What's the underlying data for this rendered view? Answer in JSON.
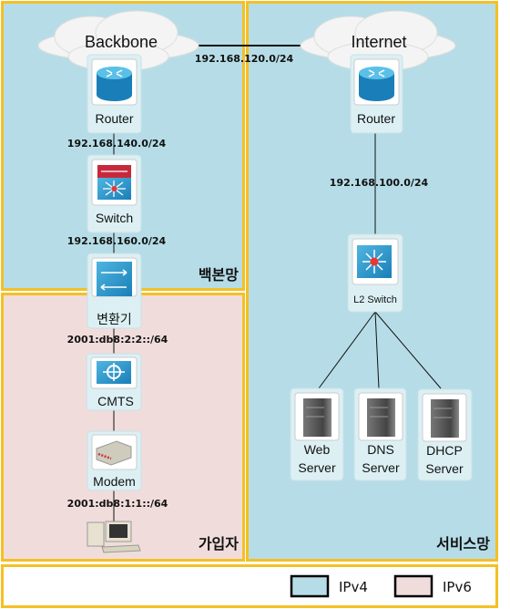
{
  "colors": {
    "ipv4": "#b6dde7",
    "ipv6": "#f1dcdc",
    "border": "#f4c025"
  },
  "regions": {
    "backbone": "백본망",
    "subscriber": "가입자",
    "service": "서비스망"
  },
  "clouds": {
    "backbone": "Backbone",
    "internet": "Internet"
  },
  "nodes": {
    "backbone_router": "Router",
    "switch": "Switch",
    "converter": "변환기",
    "cmts": "CMTS",
    "modem": "Modem",
    "internet_router": "Router",
    "l2switch": "L2 Switch",
    "web": [
      "Web",
      "Server"
    ],
    "dns": [
      "DNS",
      "Server"
    ],
    "dhcp": [
      "DHCP",
      "Server"
    ]
  },
  "links": {
    "backbone_internet": "192.168.120.0/24",
    "router_switch": "192.168.140.0/24",
    "switch_converter": "192.168.160.0/24",
    "internet_l2": "192.168.100.0/24",
    "converter_cmts": "2001:db8:2:2::/64",
    "modem_pc": "2001:db8:1:1::/64"
  },
  "legend": {
    "ipv4": "IPv4",
    "ipv6": "IPv6"
  }
}
